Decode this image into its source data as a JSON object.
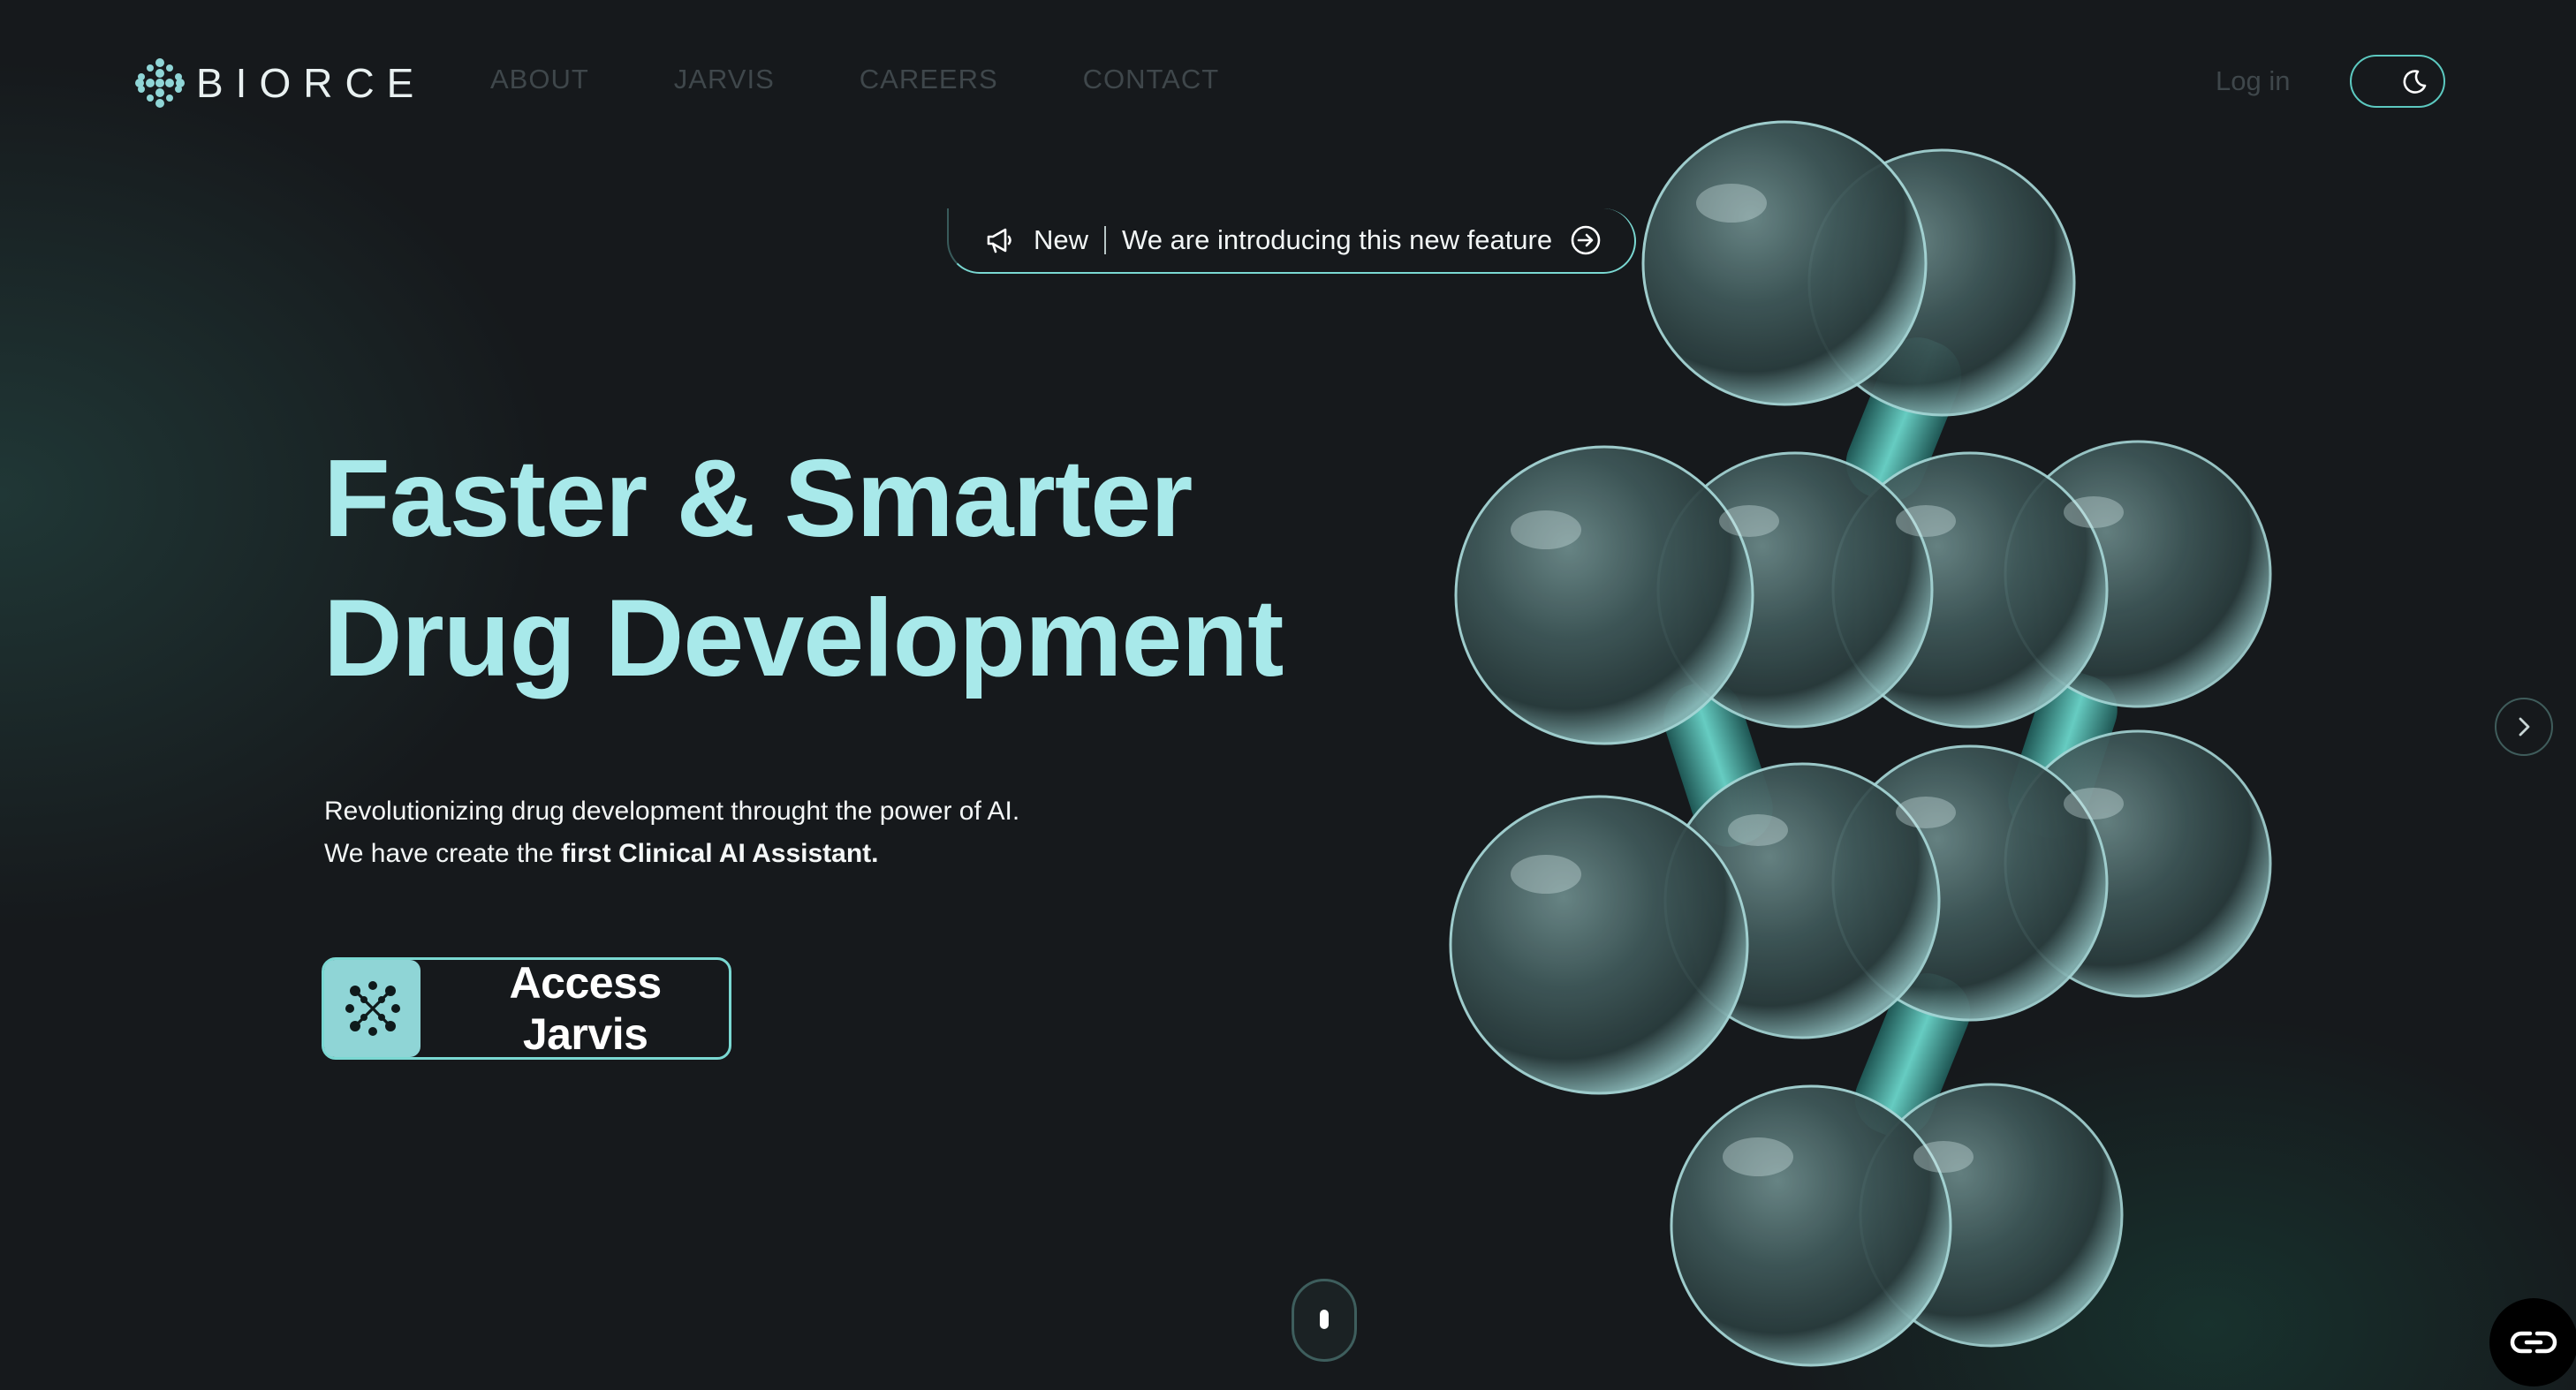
{
  "brand": {
    "name": "BIORCE",
    "logo_icon": "biorce-dots-icon"
  },
  "nav": {
    "items": [
      {
        "label": "ABOUT"
      },
      {
        "label": "JARVIS"
      },
      {
        "label": "CAREERS"
      },
      {
        "label": "CONTACT"
      }
    ]
  },
  "header": {
    "login_label": "Log in",
    "theme_icon": "moon-icon"
  },
  "announcement": {
    "tag": "New",
    "text": "We are introducing this new feature",
    "icon": "megaphone-icon",
    "arrow_icon": "arrow-right-circle-icon"
  },
  "hero": {
    "title_line1": "Faster & Smarter",
    "title_line2": "Drug Development",
    "sub_line1": "Revolutionizing drug development throught the power of AI.",
    "sub_line2_plain": "We have create the ",
    "sub_line2_bold": "first Clinical AI Assistant."
  },
  "cta": {
    "label": "Access Jarvis",
    "icon": "jarvis-molecule-icon"
  },
  "carousel": {
    "next_icon": "chevron-right-icon"
  },
  "colors": {
    "background": "#16191c",
    "accent": "#a8e9ea",
    "accent_border": "#7ad8d2",
    "nav_text": "#3f474b"
  }
}
